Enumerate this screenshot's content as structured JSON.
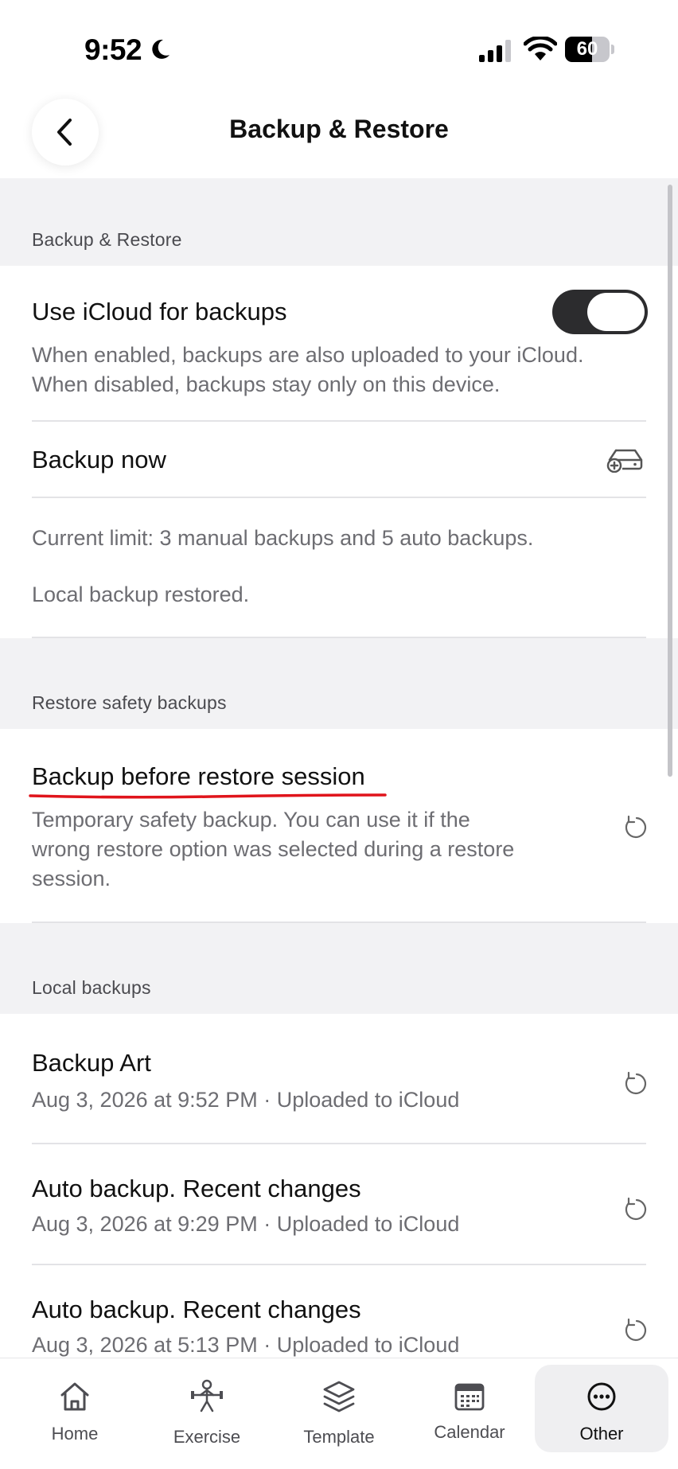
{
  "status": {
    "time": "9:52",
    "battery": "60",
    "battery_level": 0.6
  },
  "nav": {
    "title": "Backup & Restore"
  },
  "section_backup": {
    "header": "Backup & Restore",
    "icloud_title": "Use iCloud for backups",
    "icloud_desc_1": "When enabled, backups are also uploaded to your iCloud.",
    "icloud_desc_2": "When disabled, backups stay only on this device.",
    "icloud_enabled": true,
    "backup_now": "Backup now",
    "limit_text": "Current limit: 3 manual backups and 5 auto backups.",
    "restored_text": "Local backup restored."
  },
  "section_safety": {
    "header": "Restore safety backups",
    "title": "Backup before restore session",
    "desc_1": "Temporary safety backup. You can use it if the",
    "desc_2": "wrong restore option was selected during a restore",
    "desc_3": "session."
  },
  "section_local": {
    "header": "Local backups",
    "items": [
      {
        "title": "Backup Art",
        "subtitle": "Aug 3, 2026 at 9:52 PM · Uploaded to iCloud"
      },
      {
        "title": "Auto backup. Recent changes",
        "subtitle": "Aug 3, 2026 at 9:29 PM · Uploaded to iCloud"
      },
      {
        "title": "Auto backup. Recent changes",
        "subtitle": "Aug 3, 2026 at 5:13 PM · Uploaded to iCloud"
      }
    ]
  },
  "tabs": [
    {
      "label": "Home",
      "icon": "home-icon"
    },
    {
      "label": "Exercise",
      "icon": "exercise-icon"
    },
    {
      "label": "Template",
      "icon": "layers-icon"
    },
    {
      "label": "Calendar",
      "icon": "calendar-icon"
    },
    {
      "label": "Other",
      "icon": "more-icon",
      "active": true
    }
  ],
  "colors": {
    "accent_underline": "#e0141b",
    "toggle_on": "#2c2c2e"
  }
}
